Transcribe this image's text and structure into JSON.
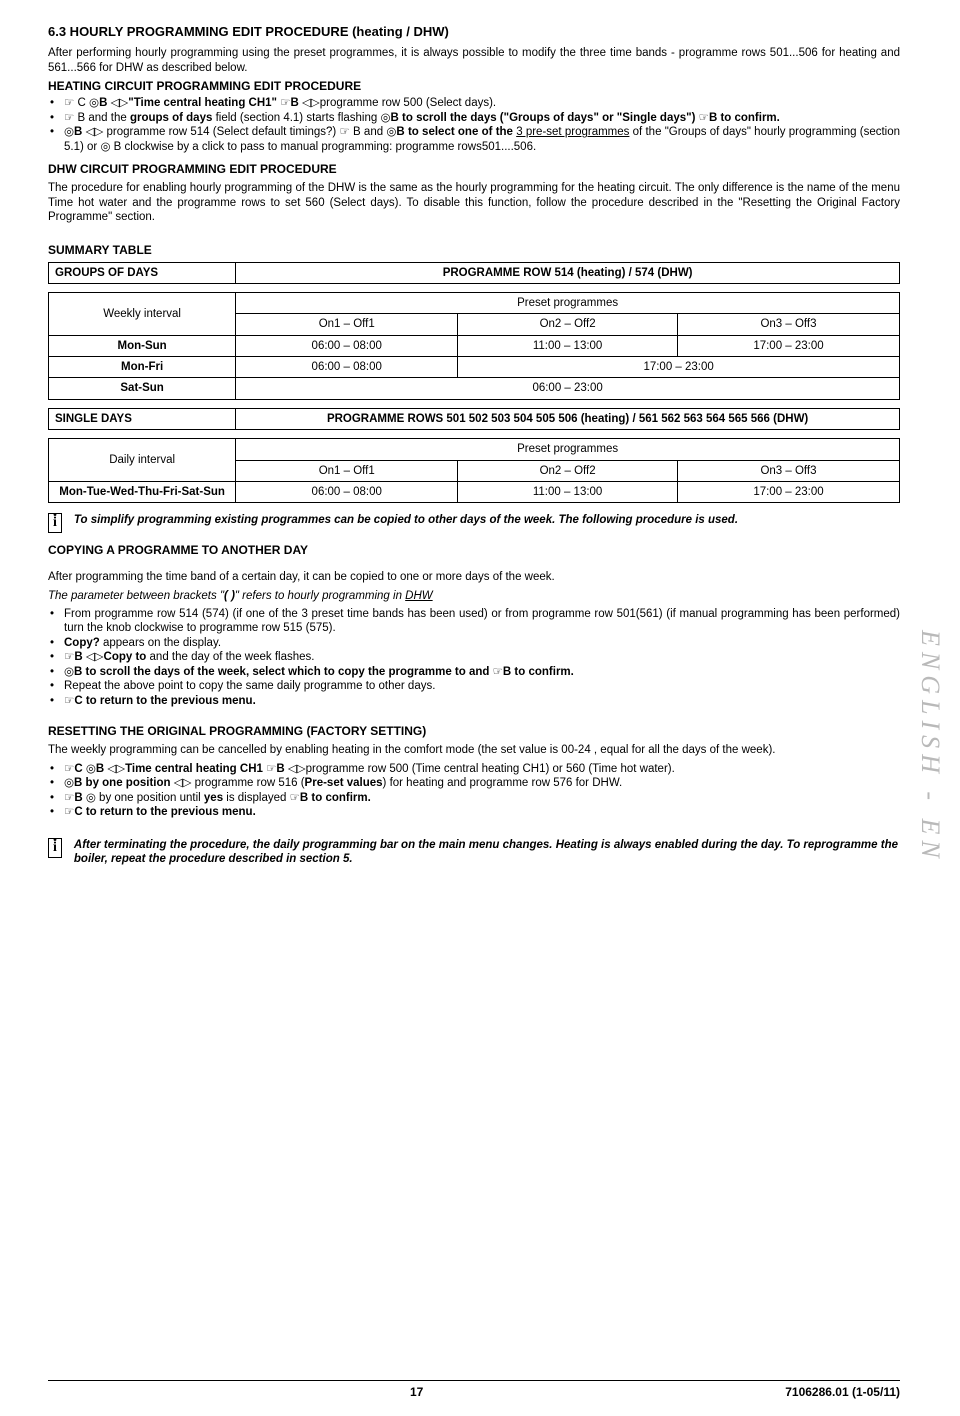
{
  "sec": {
    "title": "6.3   HOURLY PROGRAMMING EDIT PROCEDURE (heating / DHW)",
    "intro": "After performing hourly programming using the preset programmes, it is always possible to modify the three time bands - programme rows 501...506 for heating and 561...566 for DHW as described below.",
    "heat_head": "HEATING CIRCUIT PROGRAMMING EDIT PROCEDURE",
    "li1a": " C ",
    "li1b": "B ",
    "li1c": "\"Time central heating CH1\" ",
    "li1d": "B ",
    "li1e": "programme row 500 (Select days).",
    "li2a": " B and the ",
    "li2b": "groups of days",
    "li2c": " field (section 4.1) starts flashing   ",
    "li2d": "B to scroll the days (\"Groups of days\" or \"Single days\") ",
    "li2e": "B to confirm.",
    "li3a": "B   ",
    "li3b": " programme row 514 (Select default timings?) ",
    "li3c": " B  and ",
    "li3d": "B to select one of the ",
    "li3e": "3 pre-set programmes",
    "li3f": " of the \"Groups of days\" hourly programming (section 5.1) or ",
    "li3g": " B  clockwise by a click to pass to manual programming: programme rows501....506.",
    "dhw_head": "DHW CIRCUIT PROGRAMMING EDIT PROCEDURE",
    "dhw_text": "The procedure for enabling hourly programming of the DHW is the same as the hourly programming for the heating circuit. The only difference is the name of the menu Time hot water and the programme rows to set 560 (Select days). To disable this function, follow the procedure described in the \"Resetting the Original Factory Programme\" section."
  },
  "summary": {
    "title": "SUMMARY TABLE",
    "t1": {
      "h1": "GROUPS OF DAYS",
      "h2": "PROGRAMME ROW 514 (heating) / 574 (DHW)",
      "weekly": "Weekly interval",
      "preset": "Preset programmes",
      "on1": "On1 – Off1",
      "on2": "On2 – Off2",
      "on3": "On3 – Off3",
      "r1c1": "Mon-Sun",
      "r1c2": "06:00 – 08:00",
      "r1c3": "11:00 – 13:00",
      "r1c4": "17:00 – 23:00",
      "r2c1": "Mon-Fri",
      "r2c2": "06:00 – 08:00",
      "r2c3": "17:00 – 23:00",
      "r3c1": "Sat-Sun",
      "r3c2": "06:00 – 23:00"
    },
    "t2": {
      "h1": "SINGLE DAYS",
      "h2": "PROGRAMME ROWS 501 502 503 504 505 506 (heating) / 561 562 563 564 565 566 (DHW)",
      "daily": "Daily interval",
      "preset": "Preset programmes",
      "on1": "On1 – Off1",
      "on2": "On2 – Off2",
      "on3": "On3 – Off3",
      "r1c1": "Mon-Tue-Wed-Thu-Fri-Sat-Sun",
      "r1c2": "06:00 – 08:00",
      "r1c3": "11:00 – 13:00",
      "r1c4": "17:00 – 23:00"
    }
  },
  "note1": "To simplify programming existing programmes can be copied to other days of the week. The following procedure is used.",
  "copy": {
    "head": "COPYING A PROGRAMME TO ANOTHER DAY",
    "p1": "After programming the time band of a certain day, it can be copied to one or more days of the week.",
    "p2a": "The parameter between brackets \"",
    "p2b": "( )",
    "p2c": "\" refers to hourly programming in ",
    "p2d": "DHW",
    "li1": "From programme row 514 (574) (if one of the 3 preset time bands has been used) or from programme row 501(561) (if manual programming has been performed) turn the knob clockwise to programme row 515 (575).",
    "li2a": "Copy?",
    "li2b": " appears on the display.",
    "li3a": "B ",
    "li3b": "Copy to",
    "li3c": " and the day of the week flashes.",
    "li4a": "B  to scroll the days of the week, select which to copy the programme to and ",
    "li4b": "B  to confirm.",
    "li5": "Repeat the above point to copy the same daily programme to other days.",
    "li6": "C  to return to the previous menu."
  },
  "reset": {
    "head": "RESETTING THE ORIGINAL PROGRAMMING (FACTORY SETTING)",
    "p1": "The weekly programming can be cancelled by enabling heating in the comfort mode (the set value is 00-24 , equal for all the days of the week).",
    "li1a": "C ",
    "li1b": "B ",
    "li1c": "Time central heating CH1 ",
    "li1d": "B ",
    "li1e": "programme row 500 (Time central heating CH1) or 560 (Time hot water).",
    "li2a": "B by one position ",
    "li2b": " programme row 516 (",
    "li2c": "Pre-set values",
    "li2d": ") for heating and programme row 576 for DHW.",
    "li3a": "B  ",
    "li3b": "  by one position until ",
    "li3c": "yes",
    "li3d": " is displayed ",
    "li3e": "B  to confirm.",
    "li4": "C  to return to the previous menu."
  },
  "note2": "After terminating the procedure, the daily programming bar on the main menu changes. Heating is always enabled during the day. To reprogramme the boiler, repeat the procedure described in section 5.",
  "footer": {
    "page": "17",
    "code": "7106286.01 (1-05/11)"
  },
  "side": "ENGLISH - EN"
}
